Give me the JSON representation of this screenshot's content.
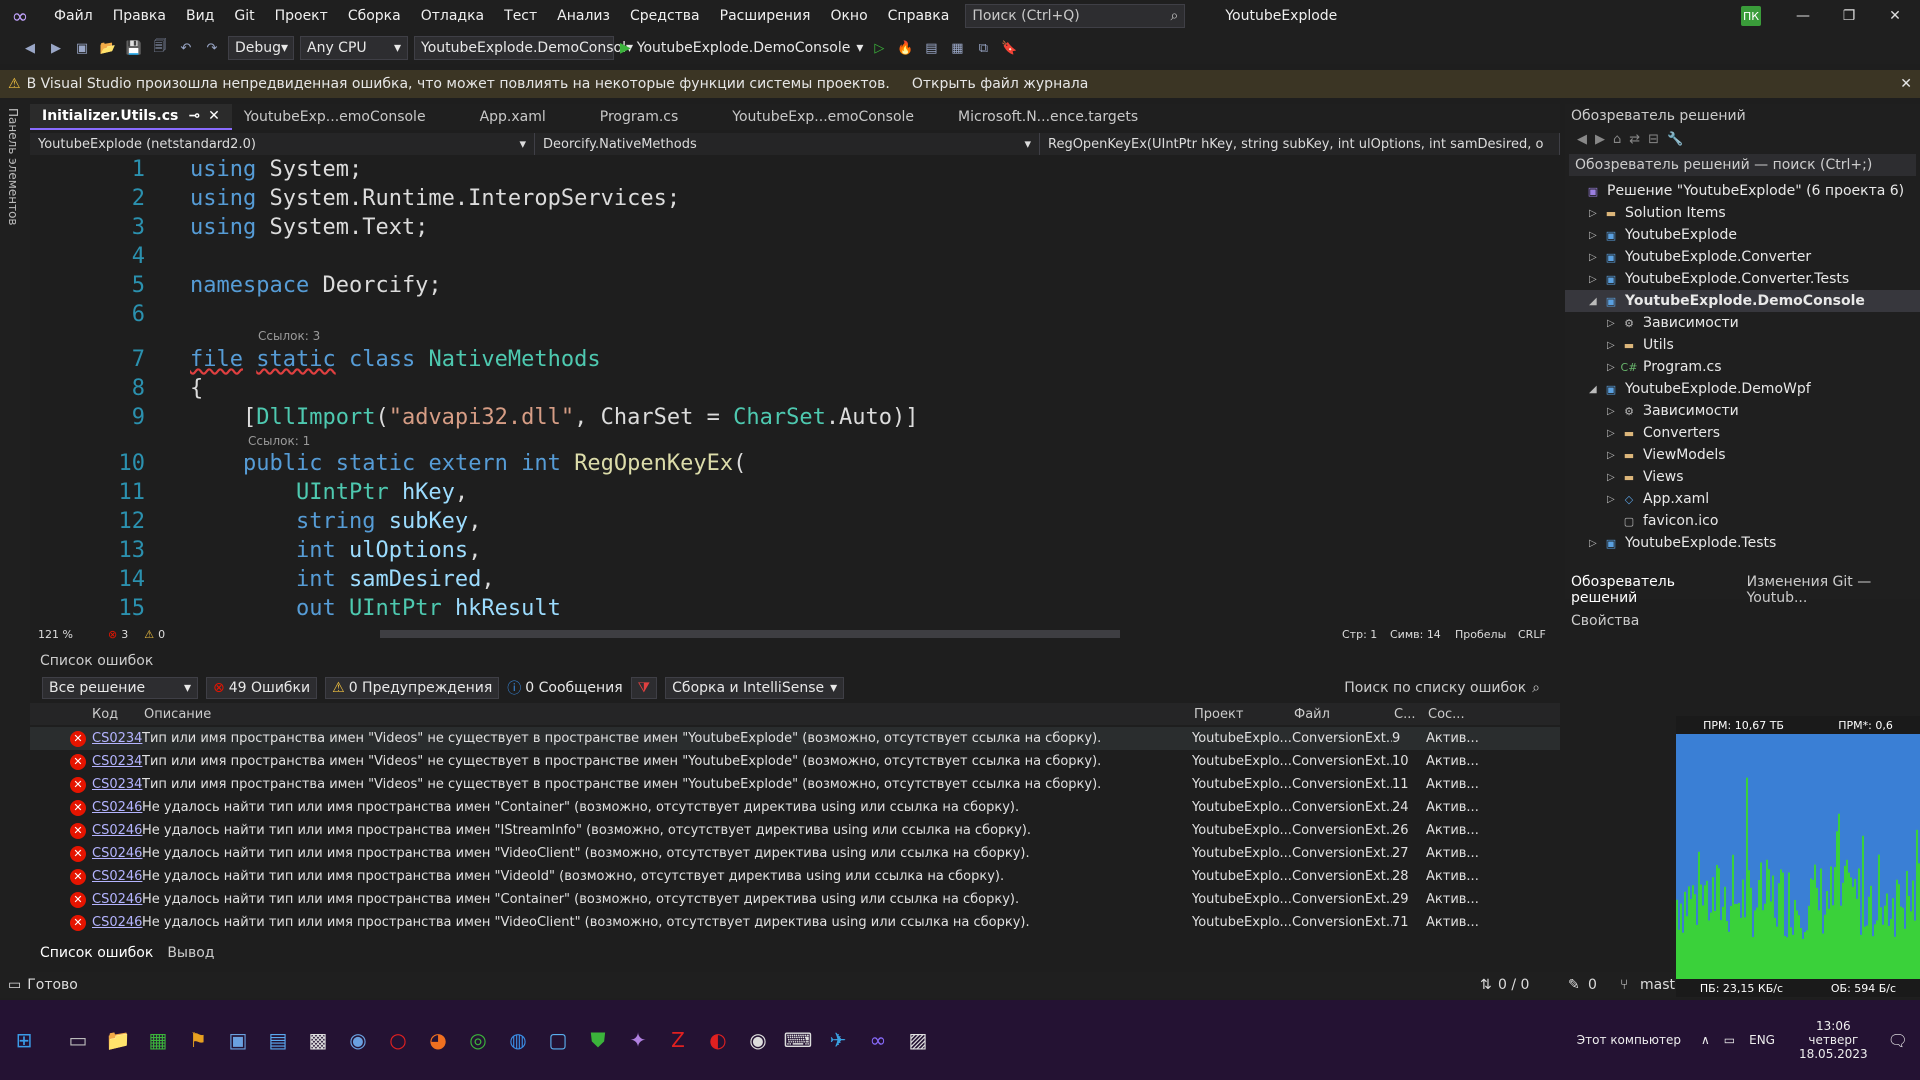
{
  "titlebar": {
    "menu": [
      "Файл",
      "Правка",
      "Вид",
      "Git",
      "Проект",
      "Сборка",
      "Отладка",
      "Тест",
      "Анализ",
      "Средства",
      "Расширения",
      "Окно",
      "Справка"
    ],
    "search_placeholder": "Поиск (Ctrl+Q)",
    "app_title": "YoutubeExplode",
    "user_initials": "ПК"
  },
  "toolbar": {
    "config": "Debug",
    "platform": "Any CPU",
    "startup_project": "YoutubeExplode.DemoConsol",
    "run_target": "YoutubeExplode.DemoConsole"
  },
  "warning": {
    "text": "В Visual Studio произошла непредвиденная ошибка, что может повлиять на некоторые функции системы проектов.",
    "link": "Открыть файл журнала"
  },
  "left_strip": "Панель элементов",
  "tabs": [
    "Initializer.Utils.cs",
    "YoutubeExp...emoConsole",
    "App.xaml",
    "Program.cs",
    "YoutubeExp...emoConsole",
    "Microsoft.N...ence.targets"
  ],
  "navbar": {
    "project": "YoutubeExplode (netstandard2.0)",
    "type": "Deorcify.NativeMethods",
    "member": "RegOpenKeyEx(UIntPtr hKey, string subKey, int ulOptions, int samDesired, o"
  },
  "code": {
    "line_numbers": [
      "1",
      "2",
      "3",
      "4",
      "5",
      "6",
      "7",
      "8",
      "9",
      "10",
      "11",
      "12",
      "13",
      "14",
      "15"
    ],
    "refs_3": "Ссылок: 3",
    "refs_1": "Ссылок: 1",
    "using": "using",
    "ns_system": "System;",
    "ns_interop": "System.Runtime.InteropServices;",
    "ns_text": "System.Text;",
    "namespace_kw": "namespace",
    "namespace_name": "Deorcify;",
    "file_kw": "file",
    "static_kw": "static",
    "class_kw": "class",
    "class_name": "NativeMethods",
    "brace": "{",
    "attr_open": "[",
    "attr_name": "DllImport",
    "attr_paren": "(",
    "attr_string": "\"advapi32.dll\"",
    "attr_mid": ", CharSet = ",
    "attr_charset": "CharSet",
    "attr_dot_auto": ".Auto)]",
    "public_kw": "public",
    "extern_kw": "extern",
    "int_kw": "int",
    "method_name": "RegOpenKeyEx",
    "paren_open": "(",
    "p1_type": "UIntPtr",
    "p1_name": "hKey",
    "p2_type": "string",
    "p2_name": "subKey",
    "p3_type": "int",
    "p3_name": "ulOptions",
    "p4_type": "int",
    "p4_name": "samDesired",
    "out_kw": "out",
    "p5_type": "UIntPtr",
    "p5_name": "hkResult",
    "comma": ","
  },
  "editor_status": {
    "zoom": "121 %",
    "errors": "3",
    "warnings": "0",
    "line": "Стр: 1",
    "col": "Симв: 14",
    "whitespace": "Пробелы",
    "eol": "CRLF"
  },
  "error_list": {
    "title": "Список ошибок",
    "scope": "Все решение",
    "errors_btn": "49 Ошибки",
    "warnings_btn": "0 Предупреждения",
    "messages_btn": "0 Сообщения",
    "build_filter": "Сборка и IntelliSense",
    "search_placeholder": "Поиск по списку ошибок",
    "columns": [
      "Код",
      "Описание",
      "Проект",
      "Файл",
      "С...",
      "Сос..."
    ],
    "rows": [
      {
        "code": "CS0234",
        "desc": "Тип или имя пространства имен \"Videos\" не существует в пространстве имен \"YoutubeExplode\" (возможно, отсутствует ссылка на сборку).",
        "proj": "YoutubeExplo...",
        "file": "ConversionExt...",
        "line": "9",
        "state": "Актив..."
      },
      {
        "code": "CS0234",
        "desc": "Тип или имя пространства имен \"Videos\" не существует в пространстве имен \"YoutubeExplode\" (возможно, отсутствует ссылка на сборку).",
        "proj": "YoutubeExplo...",
        "file": "ConversionExt...",
        "line": "10",
        "state": "Актив..."
      },
      {
        "code": "CS0234",
        "desc": "Тип или имя пространства имен \"Videos\" не существует в пространстве имен \"YoutubeExplode\" (возможно, отсутствует ссылка на сборку).",
        "proj": "YoutubeExplo...",
        "file": "ConversionExt...",
        "line": "11",
        "state": "Актив..."
      },
      {
        "code": "CS0246",
        "desc": "Не удалось найти тип или имя пространства имен \"Container\" (возможно, отсутствует директива using или ссылка на сборку).",
        "proj": "YoutubeExplo...",
        "file": "ConversionExt...",
        "line": "24",
        "state": "Актив..."
      },
      {
        "code": "CS0246",
        "desc": "Не удалось найти тип или имя пространства имен \"IStreamInfo\" (возможно, отсутствует директива using или ссылка на сборку).",
        "proj": "YoutubeExplo...",
        "file": "ConversionExt...",
        "line": "26",
        "state": "Актив..."
      },
      {
        "code": "CS0246",
        "desc": "Не удалось найти тип или имя пространства имен \"VideoClient\" (возможно, отсутствует директива using или ссылка на сборку).",
        "proj": "YoutubeExplo...",
        "file": "ConversionExt...",
        "line": "27",
        "state": "Актив..."
      },
      {
        "code": "CS0246",
        "desc": "Не удалось найти тип или имя пространства имен \"VideoId\" (возможно, отсутствует директива using или ссылка на сборку).",
        "proj": "YoutubeExplo...",
        "file": "ConversionExt...",
        "line": "28",
        "state": "Актив..."
      },
      {
        "code": "CS0246",
        "desc": "Не удалось найти тип или имя пространства имен \"Container\" (возможно, отсутствует директива using или ссылка на сборку).",
        "proj": "YoutubeExplo...",
        "file": "ConversionExt...",
        "line": "29",
        "state": "Актив..."
      },
      {
        "code": "CS0246",
        "desc": "Не удалось найти тип или имя пространства имен \"VideoClient\" (возможно, отсутствует директива using или ссылка на сборку).",
        "proj": "YoutubeExplo...",
        "file": "ConversionExt...",
        "line": "71",
        "state": "Актив..."
      }
    ],
    "bottom_tabs": [
      "Список ошибок",
      "Вывод"
    ]
  },
  "statusbar": {
    "ready": "Готово",
    "lines": "0 / 0",
    "edits": "0",
    "branch": "mast"
  },
  "solution": {
    "title": "Обозреватель решений",
    "search": "Обозреватель решений — поиск (Ctrl+;)",
    "tree": [
      {
        "label": "Решение \"YoutubeExplode\" (6 проекта 6)",
        "level": 0,
        "arrow": "",
        "icon": "solution"
      },
      {
        "label": "Solution Items",
        "level": 1,
        "arrow": "▷",
        "icon": "folder"
      },
      {
        "label": "YoutubeExplode",
        "level": 1,
        "arrow": "▷",
        "icon": "project"
      },
      {
        "label": "YoutubeExplode.Converter",
        "level": 1,
        "arrow": "▷",
        "icon": "project"
      },
      {
        "label": "YoutubeExplode.Converter.Tests",
        "level": 1,
        "arrow": "▷",
        "icon": "project"
      },
      {
        "label": "YoutubeExplode.DemoConsole",
        "level": 1,
        "arrow": "◢",
        "icon": "project",
        "selected": true
      },
      {
        "label": "Зависимости",
        "level": 2,
        "arrow": "▷",
        "icon": "deps"
      },
      {
        "label": "Utils",
        "level": 2,
        "arrow": "▷",
        "icon": "folder"
      },
      {
        "label": "Program.cs",
        "level": 2,
        "arrow": "▷",
        "icon": "cs"
      },
      {
        "label": "YoutubeExplode.DemoWpf",
        "level": 1,
        "arrow": "◢",
        "icon": "project"
      },
      {
        "label": "Зависимости",
        "level": 2,
        "arrow": "▷",
        "icon": "deps"
      },
      {
        "label": "Converters",
        "level": 2,
        "arrow": "▷",
        "icon": "folder"
      },
      {
        "label": "ViewModels",
        "level": 2,
        "arrow": "▷",
        "icon": "folder"
      },
      {
        "label": "Views",
        "level": 2,
        "arrow": "▷",
        "icon": "folder"
      },
      {
        "label": "App.xaml",
        "level": 2,
        "arrow": "▷",
        "icon": "xaml"
      },
      {
        "label": "favicon.ico",
        "level": 2,
        "arrow": "",
        "icon": "ico"
      },
      {
        "label": "YoutubeExplode.Tests",
        "level": 1,
        "arrow": "▷",
        "icon": "project"
      }
    ],
    "bottom_tabs": [
      "Обозреватель решений",
      "Изменения Git — Youtub..."
    ],
    "properties": "Свойства"
  },
  "net_widget": {
    "top_left": "ПРМ: 10,67 ТБ",
    "top_right": "ПРМ*: 0,6",
    "bottom_left": "ПБ: 23,15 КБ/с",
    "bottom_right": "ОБ: 594 Б/с"
  },
  "tray": {
    "computer": "Этот компьютер",
    "lang": "ENG",
    "time": "13:06",
    "day": "четверг",
    "date": "18.05.2023"
  }
}
